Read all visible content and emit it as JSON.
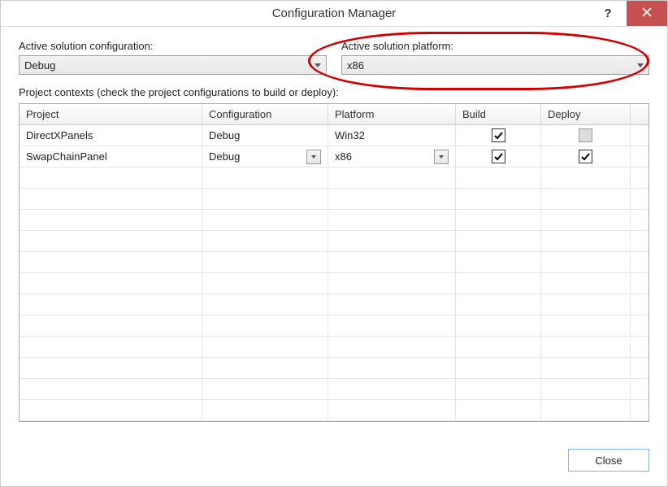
{
  "dialog": {
    "title": "Configuration Manager"
  },
  "top": {
    "config_label": "Active solution configuration:",
    "config_value": "Debug",
    "platform_label": "Active solution platform:",
    "platform_value": "x86"
  },
  "contexts_label": "Project contexts (check the project configurations to build or deploy):",
  "columns": {
    "project": "Project",
    "configuration": "Configuration",
    "platform": "Platform",
    "build": "Build",
    "deploy": "Deploy"
  },
  "rows": [
    {
      "project": "DirectXPanels",
      "configuration": "Debug",
      "config_dd_visible": false,
      "platform": "Win32",
      "platform_dd_visible": false,
      "build_checked": true,
      "deploy_checked": false,
      "deploy_enabled": false
    },
    {
      "project": "SwapChainPanel",
      "configuration": "Debug",
      "config_dd_visible": true,
      "platform": "x86",
      "platform_dd_visible": true,
      "build_checked": true,
      "deploy_checked": true,
      "deploy_enabled": true
    }
  ],
  "footer": {
    "close": "Close"
  }
}
